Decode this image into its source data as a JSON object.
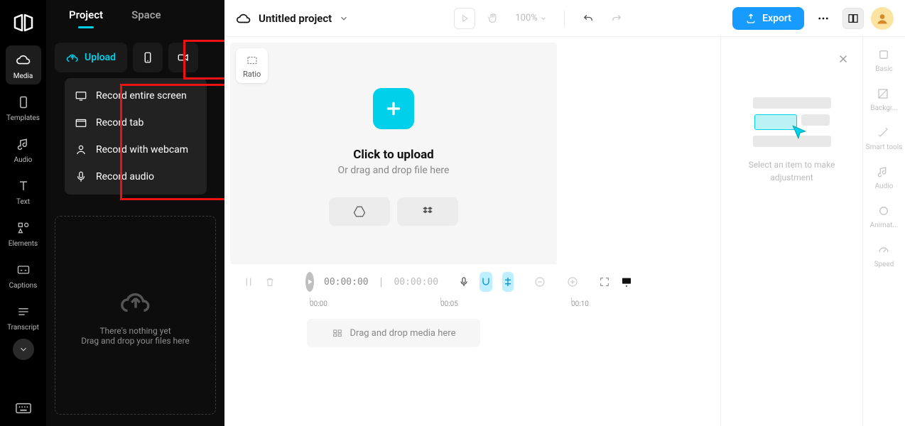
{
  "rail": {
    "items": [
      {
        "label": "Media"
      },
      {
        "label": "Templates"
      },
      {
        "label": "Audio"
      },
      {
        "label": "Text"
      },
      {
        "label": "Elements"
      },
      {
        "label": "Captions"
      },
      {
        "label": "Transcript"
      }
    ]
  },
  "panel": {
    "tabs": [
      "Project",
      "Space"
    ],
    "upload_label": "Upload",
    "record_menu": [
      "Record entire screen",
      "Record tab",
      "Record with webcam",
      "Record audio"
    ],
    "empty_line1": "There's nothing yet",
    "empty_line2": "Drag and drop your files here"
  },
  "topbar": {
    "project_title": "Untitled project",
    "zoom": "100%",
    "export_label": "Export"
  },
  "stage": {
    "ratio_label": "Ratio",
    "upload_line1": "Click to upload",
    "upload_line2": "Or drag and drop file here"
  },
  "inspector": {
    "placeholder_text": "Select an item to make adjustment",
    "items": [
      "Basic",
      "Backgr...",
      "Smart tools",
      "Audio",
      "Animat...",
      "Speed"
    ]
  },
  "timeline": {
    "current": "00:00:00",
    "total": "00:00:00",
    "ticks": [
      "00:00",
      "00:05",
      "00:10"
    ],
    "track_hint": "Drag and drop media here"
  }
}
